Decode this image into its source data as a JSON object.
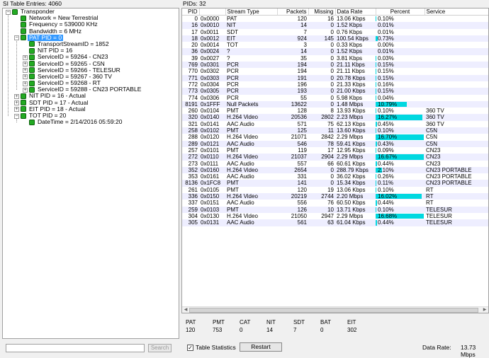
{
  "left_header": "SI Table Entries: 4060",
  "right_header": "PIDs: 32",
  "tree": [
    {
      "label": "Transponder",
      "level": 0,
      "expander": "minus",
      "selected": false
    },
    {
      "label": "Network = New Terrestrial",
      "level": 1,
      "expander": null,
      "selected": false
    },
    {
      "label": "Frequency = 539000 KHz",
      "level": 1,
      "expander": null,
      "selected": false
    },
    {
      "label": "Bandwidth = 6 MHz",
      "level": 1,
      "expander": null,
      "selected": false
    },
    {
      "label": "PAT PID = 0",
      "level": 1,
      "expander": "minus",
      "selected": true
    },
    {
      "label": "TransportStreamID = 1852",
      "level": 2,
      "expander": null,
      "selected": false
    },
    {
      "label": "NIT PID = 16",
      "level": 2,
      "expander": null,
      "selected": false
    },
    {
      "label": "ServiceID = 59264 - CN23",
      "level": 2,
      "expander": "plus",
      "selected": false
    },
    {
      "label": "ServiceID = 59265 - C5N",
      "level": 2,
      "expander": "plus",
      "selected": false
    },
    {
      "label": "ServiceID = 59266 - TELESUR",
      "level": 2,
      "expander": "plus",
      "selected": false
    },
    {
      "label": "ServiceID = 59267 - 360 TV",
      "level": 2,
      "expander": "plus",
      "selected": false
    },
    {
      "label": "ServiceID = 59268 - RT",
      "level": 2,
      "expander": "plus",
      "selected": false
    },
    {
      "label": "ServiceID = 59288 - CN23 PORTABLE",
      "level": 2,
      "expander": "plus",
      "selected": false
    },
    {
      "label": "NIT PID = 16 - Actual",
      "level": 1,
      "expander": "plus",
      "selected": false
    },
    {
      "label": "SDT PID = 17 - Actual",
      "level": 1,
      "expander": "plus",
      "selected": false
    },
    {
      "label": "EIT PID = 18 - Actual",
      "level": 1,
      "expander": "plus",
      "selected": false
    },
    {
      "label": "TOT PID = 20",
      "level": 1,
      "expander": "minus",
      "selected": false
    },
    {
      "label": "DateTime = 2/14/2016 05:59:20",
      "level": 2,
      "expander": null,
      "selected": false
    }
  ],
  "search": {
    "value": "",
    "button_label": "Search"
  },
  "grid": {
    "columns": [
      "PID",
      "",
      "Stream Type",
      "Packets",
      "Missing",
      "Data Rate",
      "Percent",
      "Service"
    ],
    "rows": [
      {
        "pid": "0",
        "hex": "0x0000",
        "type": "PAT",
        "packets": "120",
        "missing": "16",
        "rate": "13.06 Kbps",
        "percent": "0.10%",
        "service": "",
        "bar": 0.1
      },
      {
        "pid": "16",
        "hex": "0x0010",
        "type": "NIT",
        "packets": "14",
        "missing": "0",
        "rate": "1.52 Kbps",
        "percent": "0.01%",
        "service": "",
        "bar": 0.01
      },
      {
        "pid": "17",
        "hex": "0x0011",
        "type": "SDT",
        "packets": "7",
        "missing": "0",
        "rate": "0.76 Kbps",
        "percent": "0.01%",
        "service": "",
        "bar": 0.01
      },
      {
        "pid": "18",
        "hex": "0x0012",
        "type": "EIT",
        "packets": "924",
        "missing": "145",
        "rate": "100.54 Kbps",
        "percent": "0.73%",
        "service": "",
        "bar": 0.73
      },
      {
        "pid": "20",
        "hex": "0x0014",
        "type": "TOT",
        "packets": "3",
        "missing": "0",
        "rate": "0.33 Kbps",
        "percent": "0.00%",
        "service": "",
        "bar": 0
      },
      {
        "pid": "36",
        "hex": "0x0024",
        "type": "?",
        "packets": "14",
        "missing": "0",
        "rate": "1.52 Kbps",
        "percent": "0.01%",
        "service": "",
        "bar": 0.01
      },
      {
        "pid": "39",
        "hex": "0x0027",
        "type": "?",
        "packets": "35",
        "missing": "0",
        "rate": "3.81 Kbps",
        "percent": "0.03%",
        "service": "",
        "bar": 0.03
      },
      {
        "pid": "769",
        "hex": "0x0301",
        "type": "PCR",
        "packets": "194",
        "missing": "0",
        "rate": "21.11 Kbps",
        "percent": "0.15%",
        "service": "",
        "bar": 0.15
      },
      {
        "pid": "770",
        "hex": "0x0302",
        "type": "PCR",
        "packets": "194",
        "missing": "0",
        "rate": "21.11 Kbps",
        "percent": "0.15%",
        "service": "",
        "bar": 0.15
      },
      {
        "pid": "771",
        "hex": "0x0303",
        "type": "PCR",
        "packets": "191",
        "missing": "0",
        "rate": "20.78 Kbps",
        "percent": "0.15%",
        "service": "",
        "bar": 0.15
      },
      {
        "pid": "772",
        "hex": "0x0304",
        "type": "PCR",
        "packets": "196",
        "missing": "0",
        "rate": "21.33 Kbps",
        "percent": "0.16%",
        "service": "",
        "bar": 0.16
      },
      {
        "pid": "773",
        "hex": "0x0305",
        "type": "PCR",
        "packets": "193",
        "missing": "0",
        "rate": "21.00 Kbps",
        "percent": "0.15%",
        "service": "",
        "bar": 0.15
      },
      {
        "pid": "774",
        "hex": "0x0306",
        "type": "PCR",
        "packets": "55",
        "missing": "0",
        "rate": "5.98 Kbps",
        "percent": "0.04%",
        "service": "",
        "bar": 0.04
      },
      {
        "pid": "8191",
        "hex": "0x1FFF",
        "type": "Null Packets",
        "packets": "13622",
        "missing": "0",
        "rate": "1.48 Mbps",
        "percent": "10.79%",
        "service": "",
        "bar": 10.79
      },
      {
        "pid": "260",
        "hex": "0x0104",
        "type": "PMT",
        "packets": "128",
        "missing": "8",
        "rate": "13.93 Kbps",
        "percent": "0.10%",
        "service": "360 TV",
        "bar": 0.1
      },
      {
        "pid": "320",
        "hex": "0x0140",
        "type": "H.264 Video",
        "packets": "20536",
        "missing": "2802",
        "rate": "2.23 Mbps",
        "percent": "16.27%",
        "service": "360 TV",
        "bar": 16.27
      },
      {
        "pid": "321",
        "hex": "0x0141",
        "type": "AAC Audio",
        "packets": "571",
        "missing": "75",
        "rate": "62.13 Kbps",
        "percent": "0.45%",
        "service": "360 TV",
        "bar": 0.45
      },
      {
        "pid": "258",
        "hex": "0x0102",
        "type": "PMT",
        "packets": "125",
        "missing": "11",
        "rate": "13.60 Kbps",
        "percent": "0.10%",
        "service": "C5N",
        "bar": 0.1
      },
      {
        "pid": "288",
        "hex": "0x0120",
        "type": "H.264 Video",
        "packets": "21071",
        "missing": "2842",
        "rate": "2.29 Mbps",
        "percent": "16.70%",
        "service": "C5N",
        "bar": 16.7
      },
      {
        "pid": "289",
        "hex": "0x0121",
        "type": "AAC Audio",
        "packets": "546",
        "missing": "78",
        "rate": "59.41 Kbps",
        "percent": "0.43%",
        "service": "C5N",
        "bar": 0.43
      },
      {
        "pid": "257",
        "hex": "0x0101",
        "type": "PMT",
        "packets": "119",
        "missing": "17",
        "rate": "12.95 Kbps",
        "percent": "0.09%",
        "service": "CN23",
        "bar": 0.09
      },
      {
        "pid": "272",
        "hex": "0x0110",
        "type": "H.264 Video",
        "packets": "21037",
        "missing": "2904",
        "rate": "2.29 Mbps",
        "percent": "16.67%",
        "service": "CN23",
        "bar": 16.67
      },
      {
        "pid": "273",
        "hex": "0x0111",
        "type": "AAC Audio",
        "packets": "557",
        "missing": "66",
        "rate": "60.61 Kbps",
        "percent": "0.44%",
        "service": "CN23",
        "bar": 0.44
      },
      {
        "pid": "352",
        "hex": "0x0160",
        "type": "H.264 Video",
        "packets": "2654",
        "missing": "0",
        "rate": "288.79 Kbps",
        "percent": "2.10%",
        "service": "CN23 PORTABLE",
        "bar": 2.1
      },
      {
        "pid": "353",
        "hex": "0x0161",
        "type": "AAC Audio",
        "packets": "331",
        "missing": "0",
        "rate": "36.02 Kbps",
        "percent": "0.26%",
        "service": "CN23 PORTABLE",
        "bar": 0.26
      },
      {
        "pid": "8136",
        "hex": "0x1FC8",
        "type": "PMT",
        "packets": "141",
        "missing": "0",
        "rate": "15.34 Kbps",
        "percent": "0.11%",
        "service": "CN23 PORTABLE",
        "bar": 0.11
      },
      {
        "pid": "261",
        "hex": "0x0105",
        "type": "PMT",
        "packets": "120",
        "missing": "19",
        "rate": "13.06 Kbps",
        "percent": "0.10%",
        "service": "RT",
        "bar": 0.1
      },
      {
        "pid": "336",
        "hex": "0x0150",
        "type": "H.264 Video",
        "packets": "20219",
        "missing": "2744",
        "rate": "2.20 Mbps",
        "percent": "16.02%",
        "service": "RT",
        "bar": 16.02
      },
      {
        "pid": "337",
        "hex": "0x0151",
        "type": "AAC Audio",
        "packets": "556",
        "missing": "76",
        "rate": "60.50 Kbps",
        "percent": "0.44%",
        "service": "RT",
        "bar": 0.44
      },
      {
        "pid": "259",
        "hex": "0x0103",
        "type": "PMT",
        "packets": "126",
        "missing": "10",
        "rate": "13.71 Kbps",
        "percent": "0.10%",
        "service": "TELESUR",
        "bar": 0.1
      },
      {
        "pid": "304",
        "hex": "0x0130",
        "type": "H.264 Video",
        "packets": "21050",
        "missing": "2947",
        "rate": "2.29 Mbps",
        "percent": "16.68%",
        "service": "TELESUR",
        "bar": 16.68
      },
      {
        "pid": "305",
        "hex": "0x0131",
        "type": "AAC Audio",
        "packets": "561",
        "missing": "63",
        "rate": "61.04 Kbps",
        "percent": "0.44%",
        "service": "TELESUR",
        "bar": 0.44
      }
    ]
  },
  "summary": [
    {
      "label": "PAT",
      "value": "120"
    },
    {
      "label": "PMT",
      "value": "753"
    },
    {
      "label": "CAT",
      "value": "0"
    },
    {
      "label": "NIT",
      "value": "14"
    },
    {
      "label": "SDT",
      "value": "7"
    },
    {
      "label": "BAT",
      "value": "0"
    },
    {
      "label": "EIT",
      "value": "302"
    }
  ],
  "status": {
    "table_statistics_label": "Table Statistics",
    "table_statistics_checked": true,
    "restart_label": "Restart",
    "data_rate_label": "Data Rate:",
    "data_rate_value": "13.73 Mbps"
  },
  "colors": {
    "bar": "#00d8e0",
    "selection": "#3399ff",
    "folder_icon": "#22aa22"
  }
}
